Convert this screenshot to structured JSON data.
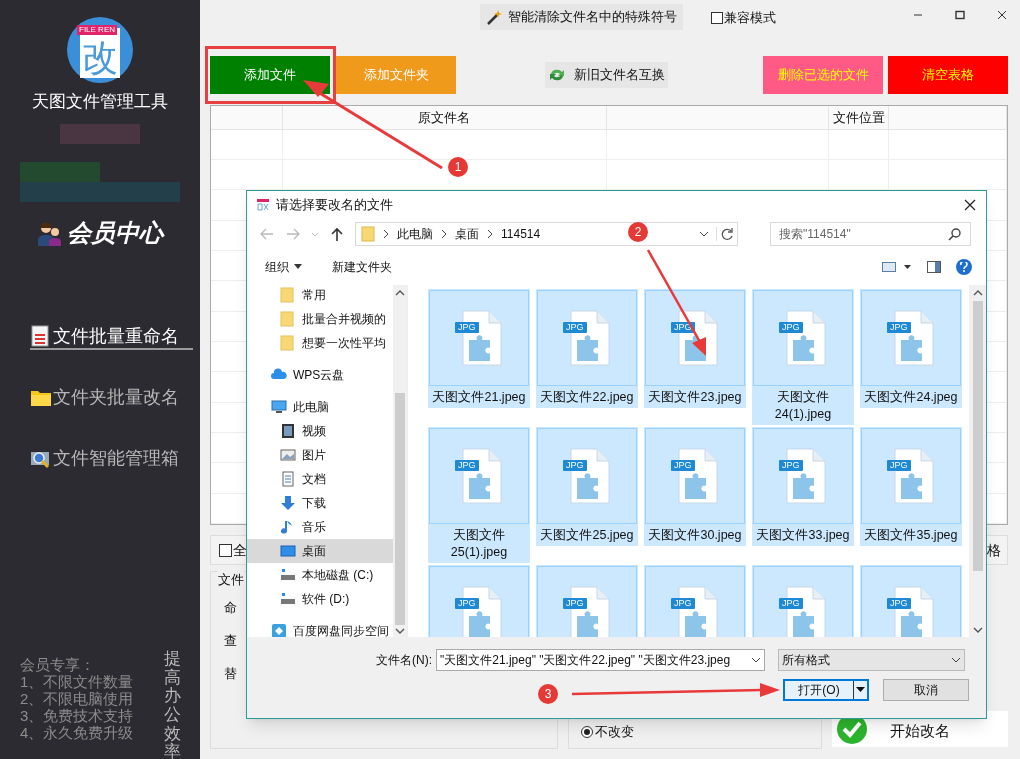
{
  "sidebar": {
    "logo": {
      "tag": "FILE REN",
      "glyph": "改"
    },
    "app_name": "天图文件管理工具",
    "member_center": "会员中心",
    "nav_items": [
      {
        "label": "文件批量重命名",
        "kind": "list",
        "selected": true
      },
      {
        "label": "文件夹批量改名",
        "kind": "folder",
        "selected": false
      },
      {
        "label": "文件智能管理箱",
        "kind": "search",
        "selected": false
      }
    ],
    "perks_title": "会员专享：",
    "perks": [
      "1、不限文件数量",
      "2、不限电脑使用",
      "3、免费技术支持",
      "4、永久免费升级"
    ],
    "slogan": "提高办公效率"
  },
  "title_bar": {
    "clean_button": "智能清除文件名中的特殊符号",
    "compat": {
      "label": "兼容模式",
      "checked": false
    }
  },
  "toolbar": {
    "left": [
      {
        "label": "添加文件",
        "color": "#008000"
      },
      {
        "label": "添加文件夹",
        "color": "#f09a1c"
      }
    ],
    "swap_button": "新旧文件名互换",
    "right": [
      {
        "label": "删除已选的文件",
        "color": "#ff5a86"
      },
      {
        "label": "清空表格",
        "color": "#ff0000"
      }
    ]
  },
  "table": {
    "columns": [
      "原文件名",
      "文件位置"
    ]
  },
  "options": {
    "select_all": {
      "label": "全",
      "checked": false
    },
    "right_label": "格",
    "group_title": "文件",
    "labels": [
      "命",
      "查",
      "替"
    ],
    "radio": {
      "label": "不改变",
      "selected": true
    },
    "start": "开始改名"
  },
  "dialog": {
    "title": "请选择要改名的文件",
    "path": [
      "此电脑",
      "桌面",
      "114514"
    ],
    "search_placeholder": "搜索\"114514\"",
    "organize": "组织",
    "new_folder": "新建文件夹",
    "quick_access": [
      {
        "label": "常用",
        "kind": "folder",
        "selected": false
      },
      {
        "label": "批量合并视频的",
        "kind": "folder",
        "selected": false
      },
      {
        "label": "想要一次性平均",
        "kind": "folder",
        "selected": false
      }
    ],
    "tree": [
      {
        "label": "WPS云盘",
        "kind": "cloud",
        "selected": false
      },
      {
        "label": "此电脑",
        "kind": "pc",
        "selected": false,
        "children": [
          {
            "label": "视频",
            "kind": "video",
            "selected": false
          },
          {
            "label": "图片",
            "kind": "picture",
            "selected": false
          },
          {
            "label": "文档",
            "kind": "document",
            "selected": false
          },
          {
            "label": "下载",
            "kind": "download",
            "selected": false
          },
          {
            "label": "音乐",
            "kind": "music",
            "selected": false
          },
          {
            "label": "桌面",
            "kind": "desktop",
            "selected": true
          },
          {
            "label": "本地磁盘 (C:)",
            "kind": "drive",
            "selected": false
          },
          {
            "label": "软件 (D:)",
            "kind": "drive",
            "selected": false
          }
        ]
      },
      {
        "label": "百度网盘同步空间",
        "kind": "sync",
        "selected": false
      }
    ],
    "files": [
      {
        "name": "天图文件21.jpeg",
        "type": "JPG",
        "selected": true
      },
      {
        "name": "天图文件22.jpeg",
        "type": "JPG",
        "selected": true
      },
      {
        "name": "天图文件23.jpeg",
        "type": "JPG",
        "selected": true
      },
      {
        "name": "天图文件\n24(1).jpeg",
        "type": "JPG",
        "selected": true
      },
      {
        "name": "天图文件24.jpeg",
        "type": "JPG",
        "selected": true
      },
      {
        "name": "天图文件\n25(1).jpeg",
        "type": "JPG",
        "selected": true
      },
      {
        "name": "天图文件25.jpeg",
        "type": "JPG",
        "selected": true
      },
      {
        "name": "天图文件30.jpeg",
        "type": "JPG",
        "selected": true
      },
      {
        "name": "天图文件33.jpeg",
        "type": "JPG",
        "selected": true
      },
      {
        "name": "天图文件35.jpeg",
        "type": "JPG",
        "selected": true
      },
      {
        "type": "JPG",
        "selected": true
      },
      {
        "type": "JPG",
        "selected": true
      },
      {
        "type": "JPG",
        "selected": true
      },
      {
        "type": "JPG",
        "selected": true
      },
      {
        "type": "JPG",
        "selected": true
      }
    ],
    "filename_label": "文件名(N):",
    "filename_value": "\"天图文件21.jpeg\" \"天图文件22.jpeg\" \"天图文件23.jpeg",
    "filter": "所有格式",
    "open": "打开(O)",
    "cancel": "取消"
  },
  "annotations": [
    "1",
    "2",
    "3"
  ]
}
